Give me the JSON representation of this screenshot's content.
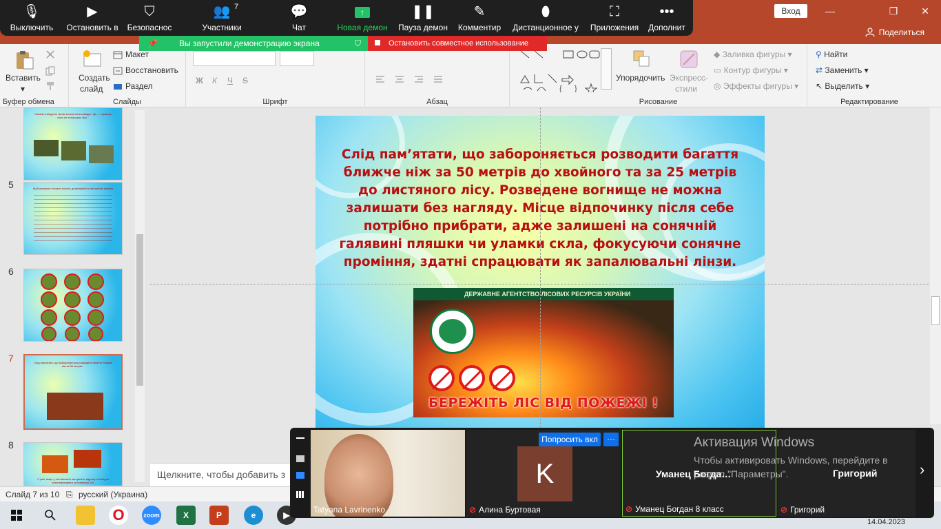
{
  "window": {
    "login_label": "Вход",
    "share_label": "Поделиться",
    "minimize_glyph": "—",
    "restore_glyph": "❐",
    "close_glyph": "✕",
    "share_icon": "user-share-icon"
  },
  "zoom_bar": {
    "items": [
      {
        "label": "Выключить",
        "icon": "microphone-icon"
      },
      {
        "label": "Остановить в",
        "icon": "camera-icon"
      },
      {
        "label": "Безопаснос",
        "icon": "shield-icon"
      },
      {
        "label": "Участники",
        "icon": "participants-icon",
        "count": "7"
      },
      {
        "label": "Чат",
        "icon": "chat-icon"
      },
      {
        "label": "Новая демон",
        "icon": "share-screen-icon"
      },
      {
        "label": "Пауза демон",
        "icon": "pause-icon"
      },
      {
        "label": "Комментир",
        "icon": "pencil-icon"
      },
      {
        "label": "Дистанционное у",
        "icon": "mouse-icon"
      },
      {
        "label": "Приложения",
        "icon": "apps-icon"
      },
      {
        "label": "Дополнит",
        "icon": "more-icon"
      }
    ],
    "sharing_label": "Вы запустили демонстрацию экрана",
    "stop_label": "Остановить совместное использование",
    "accent_green": "#23c266",
    "accent_red": "#e02a2a"
  },
  "ribbon": {
    "clipboard": {
      "label": "Буфер обмена",
      "paste": "Вставить"
    },
    "slides": {
      "label": "Слайды",
      "new_slide_line1": "Создать",
      "new_slide_line2": "слайд",
      "layout": "Макет",
      "reset": "Восстановить",
      "section": "Раздел"
    },
    "font": {
      "label": "Шрифт",
      "bold": "Ж",
      "italic": "К",
      "underline": "Ч",
      "strike": "S"
    },
    "paragraph": {
      "label": "Абзац"
    },
    "drawing": {
      "label": "Рисование",
      "arrange": "Упорядочить",
      "styles_line1": "Экспресс-",
      "styles_line2": "стили",
      "fill": "Заливка фигуры",
      "outline": "Контур фигуры",
      "effects": "Эффекты фигуры"
    },
    "editing": {
      "label": "Редактирование",
      "find": "Найти",
      "replace": "Заменить",
      "select": "Выделить"
    }
  },
  "slides_panel": {
    "items": [
      {
        "number": "",
        "text": "Пожежі знищують лісові екосистеми швидко. Це — страшне лихо не тільки для лісу..."
      },
      {
        "number": "5",
        "text": "Щоб уникнути лісових пожеж, дотримуйтеся наступних правил"
      },
      {
        "number": "6",
        "text": ""
      },
      {
        "number": "7",
        "text": "Слід пам'ятати, що забороняється розводити багаття ближче ніж за 50 метрів..."
      },
      {
        "number": "8",
        "text": "У разі, якщо у лісі виникло загоряння, відразу необхідно зателефонувати за номером 101"
      }
    ]
  },
  "slide": {
    "text": "Слід пам’ятати, що забороняється розводити багаття ближче ніж за 50 метрів до хвойного та за 25 метрів до листяного лісу. Розведене вогнище не можна залишати без нагляду. Місце відпочинку після себе потрібно прибрати, адже залишені на сонячній галявині пляшки чи уламки скла, фокусуючи сонячне проміння, здатні спрацювати як запалювальні лінзи.",
    "poster_header": "ДЕРЖАВНЕ АГЕНТСТВО ЛІСОВИХ РЕСУРСІВ УКРАЇНИ",
    "poster_footer": "БЕРЕЖІТЬ ЛІС ВІД ПОЖЕЖІ !",
    "text_color": "#b80f0f"
  },
  "notes": {
    "placeholder": "Щелкните, чтобы добавить з"
  },
  "status_bar": {
    "slide_counter": "Слайд 7 из 10",
    "language": "русский (Украина)"
  },
  "video_strip": {
    "ask_label": "Попросить вкл",
    "more_label": "···",
    "next_glyph": "›",
    "participants": [
      {
        "name": "Tatyana Lavrinenko",
        "muted": false
      },
      {
        "name": "Алина Буртовая",
        "muted": true,
        "avatar_letter": "K"
      },
      {
        "name": "Уманец Богдан 8 класс",
        "muted": true,
        "short_name": "Уманец Богда…"
      },
      {
        "name": "Григорий",
        "muted": true,
        "short_name": "Григорий"
      }
    ]
  },
  "activation": {
    "title": "Активация Windows",
    "body": "Чтобы активировать Windows, перейдите в раздел \"Параметры\"."
  },
  "taskbar": {
    "date": "14.04.2023",
    "apps": [
      "windows-start-icon",
      "search-icon",
      "file-explorer-icon",
      "opera-icon",
      "zoom-icon",
      "excel-icon",
      "powerpoint-icon",
      "edge-icon",
      "media-icon"
    ],
    "zoom_label": "zoom"
  }
}
